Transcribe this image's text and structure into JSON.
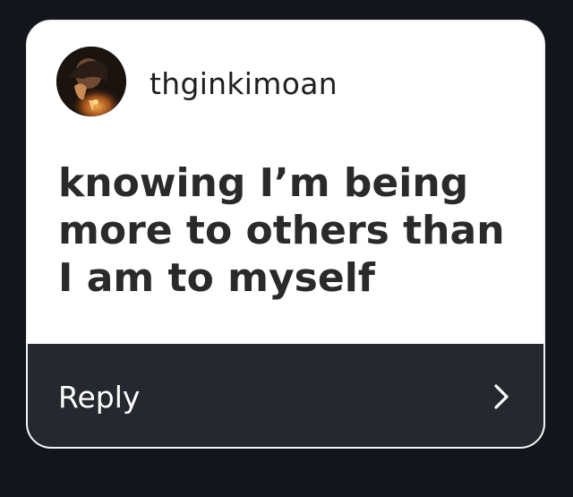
{
  "post": {
    "username": "thginkimoan",
    "avatar_icon": "profile-photo",
    "message": "knowing I’m being more to others than I am to myself"
  },
  "reply": {
    "label": "Reply",
    "icon": "chevron-right-icon"
  },
  "colors": {
    "background": "#12151b",
    "card_top": "#ffffff",
    "card_bottom": "#25282f",
    "text_dark": "#2a2a2a",
    "text_light": "#ffffff"
  }
}
